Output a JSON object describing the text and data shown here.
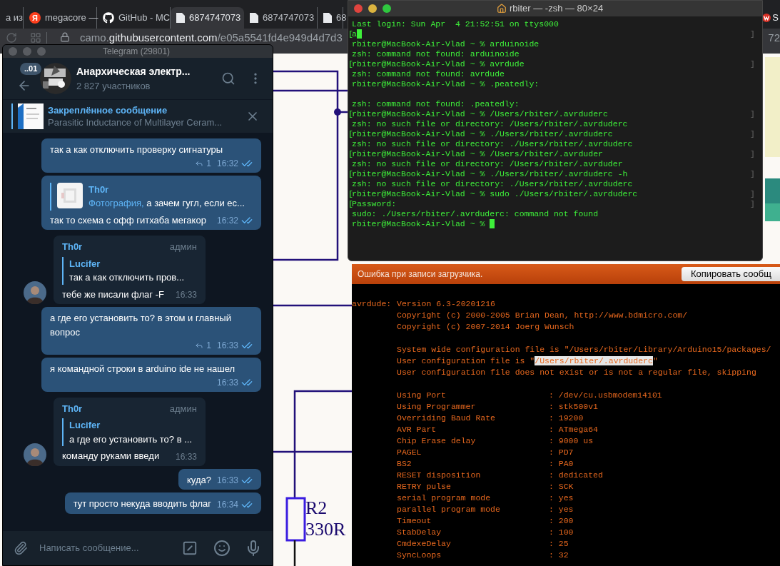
{
  "browser": {
    "tabs": [
      {
        "label": "а из",
        "kind": "plain",
        "selected": false
      },
      {
        "label": "megacore —",
        "kind": "letter",
        "icon_text": "Я",
        "selected": false
      },
      {
        "label": "GitHub - MC",
        "kind": "cat",
        "selected": false
      },
      {
        "label": "6874747073",
        "kind": "document",
        "selected": true
      },
      {
        "label": "6874747073",
        "kind": "document",
        "selected": false
      },
      {
        "label": "68",
        "kind": "document",
        "selected": false
      }
    ],
    "right_tab": {
      "label": "S"
    },
    "address": {
      "prefix": "camo.",
      "domain": "githubusercontent.com",
      "path": "/e05a5541fd4e949d4d7d3",
      "tail": "72"
    },
    "schematic": {
      "labels": [
        "R2",
        "330R"
      ]
    }
  },
  "telegram": {
    "title": "Telegram (29801)",
    "back_badge": "..01",
    "chat_name": "Анархическая электр...",
    "members": "2 827 участников",
    "pinned": {
      "title": "Закреплённое сообщение",
      "text": "Parasitic Inductance of Multilayer Ceram..."
    },
    "messages": [
      {
        "kind": "out",
        "text": "так а как отключить проверку сигнатуры",
        "replies": "1",
        "time": "16:32",
        "read": true
      },
      {
        "kind": "out",
        "reply": {
          "author": "Th0r",
          "prefix": "Фотография,",
          "text": "а зачем гугл, если ес..."
        },
        "text": "так то схема с офф гитхаба мегакор",
        "time": "16:32",
        "read": true
      },
      {
        "kind": "in",
        "author": "Th0r",
        "role": "админ",
        "reply": {
          "author": "Lucifer",
          "text": "так а как отключить пров..."
        },
        "text": "тебе же писали флаг -F",
        "time": "16:33"
      },
      {
        "kind": "out",
        "text": "а где его установить то? в этом и главный вопрос",
        "replies": "1",
        "time": "16:33",
        "read": true
      },
      {
        "kind": "out",
        "text": "я командной строки в arduino ide не нашел",
        "time": "16:33",
        "read": true
      },
      {
        "kind": "in",
        "author": "Th0r",
        "role": "админ",
        "reply": {
          "author": "Lucifer",
          "text": "а где его установить то? в ..."
        },
        "text": "команду руками введи",
        "time": "16:33"
      },
      {
        "kind": "out",
        "text": "куда?",
        "time": "16:33",
        "read": true
      },
      {
        "kind": "out",
        "text": "тут просто некуда вводить флаг",
        "time": "16:34",
        "read": true
      }
    ],
    "input": {
      "placeholder": "Написать сообщение..."
    }
  },
  "terminal": {
    "title": "rbiter — -zsh — 80×24",
    "lines": [
      {
        "text": "Last login: Sun Apr  4 21:52:51 on ttys000"
      },
      {
        "start": "[",
        "text": "a",
        "end": "]",
        "cursor": true
      },
      {
        "text": "rbiter@MacBook-Air-Vlad ~ % arduinoide"
      },
      {
        "text": "zsh: command not found: arduinoide"
      },
      {
        "start": "[",
        "text": "rbiter@MacBook-Air-Vlad ~ % avrdude",
        "end": "]"
      },
      {
        "text": "zsh: command not found: avrdude"
      },
      {
        "text": "rbiter@MacBook-Air-Vlad ~ % .peatedly:"
      },
      {
        "text": "zsh: command not found: .peatedly:",
        "blank_before": true
      },
      {
        "start": "[",
        "text": "rbiter@MacBook-Air-Vlad ~ % /Users/rbiter/.avrduderc",
        "end": "]"
      },
      {
        "text": "zsh: no such file or directory: /Users/rbiter/.avrduderc"
      },
      {
        "start": "[",
        "text": "rbiter@MacBook-Air-Vlad ~ % ./Users/rbiter/.avrduderc",
        "end": "]"
      },
      {
        "text": "zsh: no such file or directory: ./Users/rbiter/.avrduderc"
      },
      {
        "start": "[",
        "text": "rbiter@MacBook-Air-Vlad ~ % /Users/rbiter/.avrduder",
        "end": "]"
      },
      {
        "text": "zsh: no such file or directory: /Users/rbiter/.avrduder"
      },
      {
        "start": "[",
        "text": "rbiter@MacBook-Air-Vlad ~ % ./Users/rbiter/.avrduderc -h",
        "end": "]"
      },
      {
        "text": "zsh: no such file or directory: ./Users/rbiter/.avrduderc"
      },
      {
        "start": "[",
        "text": "rbiter@MacBook-Air-Vlad ~ % sudo ./Users/rbiter/.avrduderc",
        "end": "]"
      },
      {
        "start": "[",
        "text": "Password:",
        "end": "]"
      },
      {
        "text": "sudo: ./Users/rbiter/.avrduderc: command not found"
      },
      {
        "text": "rbiter@MacBook-Air-Vlad ~ % ",
        "cursor": true
      }
    ]
  },
  "arduino": {
    "status": "Ошибка при записи загрузчика.",
    "copy_button": "Копировать сообщ",
    "prefix": "avrdude:",
    "lines": [
      {
        "text": "Version 6.3-20201216"
      },
      {
        "text": "Copyright (c) 2000-2005 Brian Dean, http://www.bdmicro.com/"
      },
      {
        "text": "Copyright (c) 2007-2014 Joerg Wunsch"
      },
      {
        "text": "System wide configuration file is \"/Users/rbiter/Library/Arduino15/packages/",
        "blank_before": true
      },
      {
        "text": "User configuration file is \"",
        "highlight": "/Users/rbiter/.avrduderc",
        "after": "\""
      },
      {
        "text": "User configuration file does not exist or is not a regular file, skipping"
      }
    ],
    "settings": [
      {
        "name": "Using Port",
        "value": ": /dev/cu.usbmodem14101"
      },
      {
        "name": "Using Programmer",
        "value": ": stk500v1"
      },
      {
        "name": "Overriding Baud Rate",
        "value": ": 19200"
      },
      {
        "name": "AVR Part",
        "value": ": ATmega64"
      },
      {
        "name": "Chip Erase delay",
        "value": ": 9000 us"
      },
      {
        "name": "PAGEL",
        "value": ": PD7"
      },
      {
        "name": "BS2",
        "value": ": PA0"
      },
      {
        "name": "RESET disposition",
        "value": ": dedicated"
      },
      {
        "name": "RETRY pulse",
        "value": ": SCK"
      },
      {
        "name": "serial program mode",
        "value": ": yes"
      },
      {
        "name": "parallel program mode",
        "value": ": yes"
      },
      {
        "name": "Timeout",
        "value": ": 200"
      },
      {
        "name": "StabDelay",
        "value": ": 100"
      },
      {
        "name": "CmdexeDelay",
        "value": ": 25"
      },
      {
        "name": "SyncLoops",
        "value": ": 32"
      }
    ]
  }
}
